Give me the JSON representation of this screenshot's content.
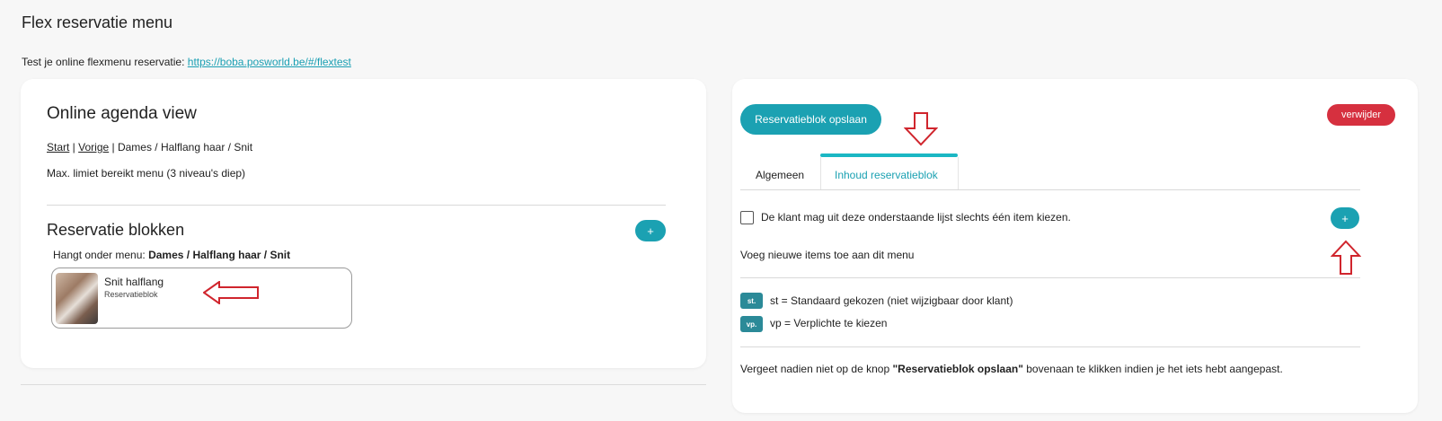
{
  "page": {
    "title": "Flex reservatie menu",
    "test_text": "Test je online flexmenu reservatie: ",
    "test_link": "https://boba.posworld.be/#/flextest"
  },
  "left": {
    "title": "Online agenda view",
    "breadcrumb": {
      "start": "Start",
      "sep1": " | ",
      "vorige": "Vorige",
      "rest": " | Dames / Halflang haar / Snit"
    },
    "limit_text": "Max. limiet bereikt menu (3 niveau's diep)",
    "section_title": "Reservatie blokken",
    "add_label": "+",
    "hang_label": "Hangt onder menu: ",
    "hang_value": "Dames / Halflang haar / Snit",
    "block": {
      "name": "Snit halflang",
      "type": "Reservatieblok"
    }
  },
  "right": {
    "save_button": "Reservatieblok opslaan",
    "delete_button": "verwijder",
    "tabs": [
      {
        "label": "Algemeen",
        "active": false
      },
      {
        "label": "Inhoud reservatieblok",
        "active": true
      }
    ],
    "checkbox_label": "De klant mag uit deze onderstaande lijst slechts één item kiezen.",
    "add_label": "+",
    "add_text": "Voeg nieuwe items toe aan dit menu",
    "legend": [
      {
        "badge": "st.",
        "text": "st = Standaard gekozen (niet wijzigbaar door klant)"
      },
      {
        "badge": "vp.",
        "text": "vp = Verplichte te kiezen"
      }
    ],
    "footer": {
      "before": "Vergeet nadien niet op de knop ",
      "bold": "\"Reservatieblok opslaan\"",
      "after": " bovenaan te klikken indien je het iets hebt aangepast."
    }
  },
  "colors": {
    "accent": "#1ba1b2",
    "danger": "#d6303f",
    "annotation_arrow": "#d0252d"
  }
}
